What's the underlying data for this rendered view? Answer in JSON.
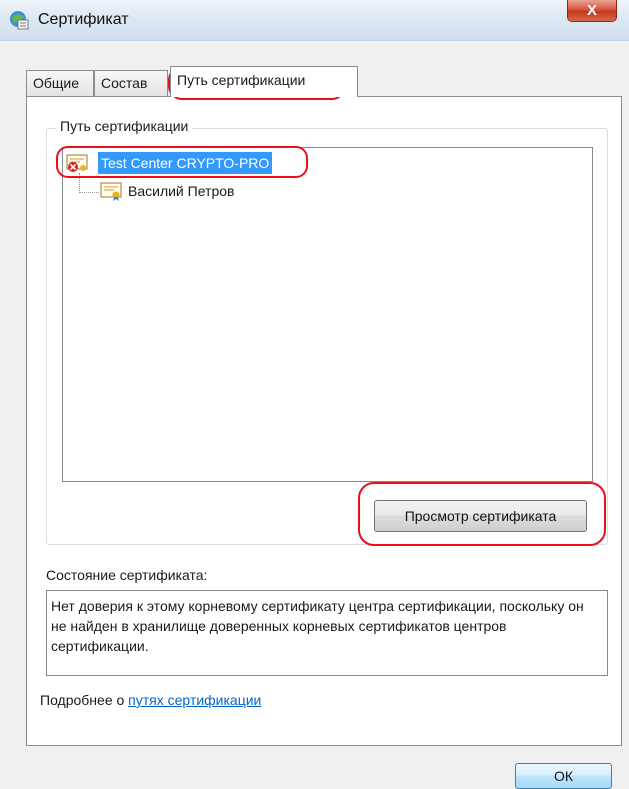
{
  "window": {
    "title": "Сертификат",
    "close_label": "X"
  },
  "tabs": [
    {
      "label": "Общие"
    },
    {
      "label": "Состав"
    },
    {
      "label": "Путь сертификации",
      "active": true
    }
  ],
  "path_group": {
    "label": "Путь сертификации",
    "tree": [
      {
        "label": "Test Center CRYPTO-PRO",
        "level": 0,
        "selected": true,
        "icon": "certificate-error-icon"
      },
      {
        "label": "Василий Петров",
        "level": 1,
        "selected": false,
        "icon": "certificate-icon"
      }
    ],
    "view_button_label": "Просмотр сертификата"
  },
  "status": {
    "label": "Состояние сертификата:",
    "text": "Нет доверия к этому корневому сертификату центра сертификации, поскольку он не найден в хранилище доверенных корневых сертификатов центров сертификации."
  },
  "more": {
    "prefix": "Подробнее о ",
    "link": "путях сертификации"
  },
  "ok_label": "ОК",
  "colors": {
    "highlight": "#e8101a",
    "selection": "#3399ff",
    "link": "#0066cc"
  }
}
